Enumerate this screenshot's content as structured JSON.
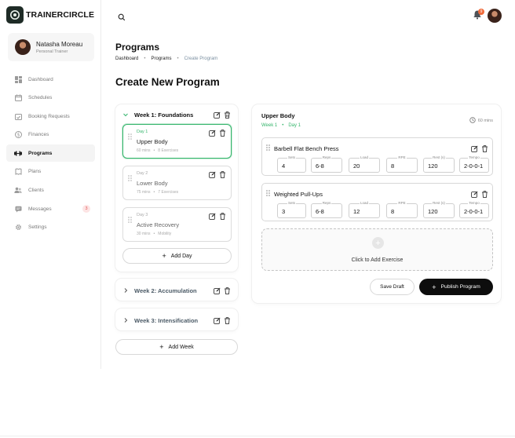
{
  "brand": {
    "name": "TRAINERCIRCLE"
  },
  "user": {
    "name": "Natasha Moreau",
    "role": "Personal Trainer"
  },
  "nav": [
    {
      "label": "Dashboard",
      "icon": "dashboard-icon"
    },
    {
      "label": "Schedules",
      "icon": "calendar-icon"
    },
    {
      "label": "Booking Requests",
      "icon": "calendar-check-icon"
    },
    {
      "label": "Finances",
      "icon": "dollar-icon"
    },
    {
      "label": "Programs",
      "icon": "dumbbell-icon",
      "active": true
    },
    {
      "label": "Plans",
      "icon": "book-icon"
    },
    {
      "label": "Clients",
      "icon": "users-icon"
    },
    {
      "label": "Messages",
      "icon": "message-icon",
      "badge": "3"
    },
    {
      "label": "Settings",
      "icon": "gear-icon"
    }
  ],
  "topbar": {
    "notifications": "9"
  },
  "header": {
    "title": "Programs",
    "breadcrumb": [
      "Dashboard",
      "Programs",
      "Create Program"
    ],
    "form_title": "Create New Program"
  },
  "weeks": [
    {
      "title": "Week 1: Foundations",
      "days": [
        {
          "kicker": "Day 1",
          "name": "Upper Body",
          "duration": "60 mins",
          "exercises": "8 Exercises"
        },
        {
          "kicker": "Day 2",
          "name": "Lower Body",
          "duration": "75 mins",
          "exercises": "7 Exercises"
        },
        {
          "kicker": "Day 3",
          "name": "Active Recovery",
          "duration": "30 mins",
          "exercises": "Mobility"
        }
      ],
      "add_day": "Add Day"
    },
    {
      "title": "Week 2: Accumulation"
    },
    {
      "title": "Week 3: Intensification"
    }
  ],
  "add_week": "Add Week",
  "detail": {
    "title": "Upper Body",
    "week": "Week 1",
    "day": "Day 1",
    "duration": "60 mins",
    "field_labels": [
      "Sets",
      "Reps",
      "Load",
      "RPE",
      "Rest (s)",
      "Tempo"
    ],
    "exercises": [
      {
        "name": "Barbell Flat Bench Press",
        "values": [
          "4",
          "6-8",
          "20",
          "8",
          "120",
          "2-0-0-1"
        ]
      },
      {
        "name": "Weighted Pull-Ups",
        "values": [
          "3",
          "6-8",
          "12",
          "8",
          "120",
          "2-0-0-1"
        ]
      }
    ],
    "add_exercise": "Click to Add Exercise",
    "save_draft": "Save Draft",
    "publish": "Publish Program"
  },
  "colors": {
    "accent_green": "#35b56c",
    "primary_dark": "#0d0d0d",
    "badge_orange": "#f06a3a"
  }
}
